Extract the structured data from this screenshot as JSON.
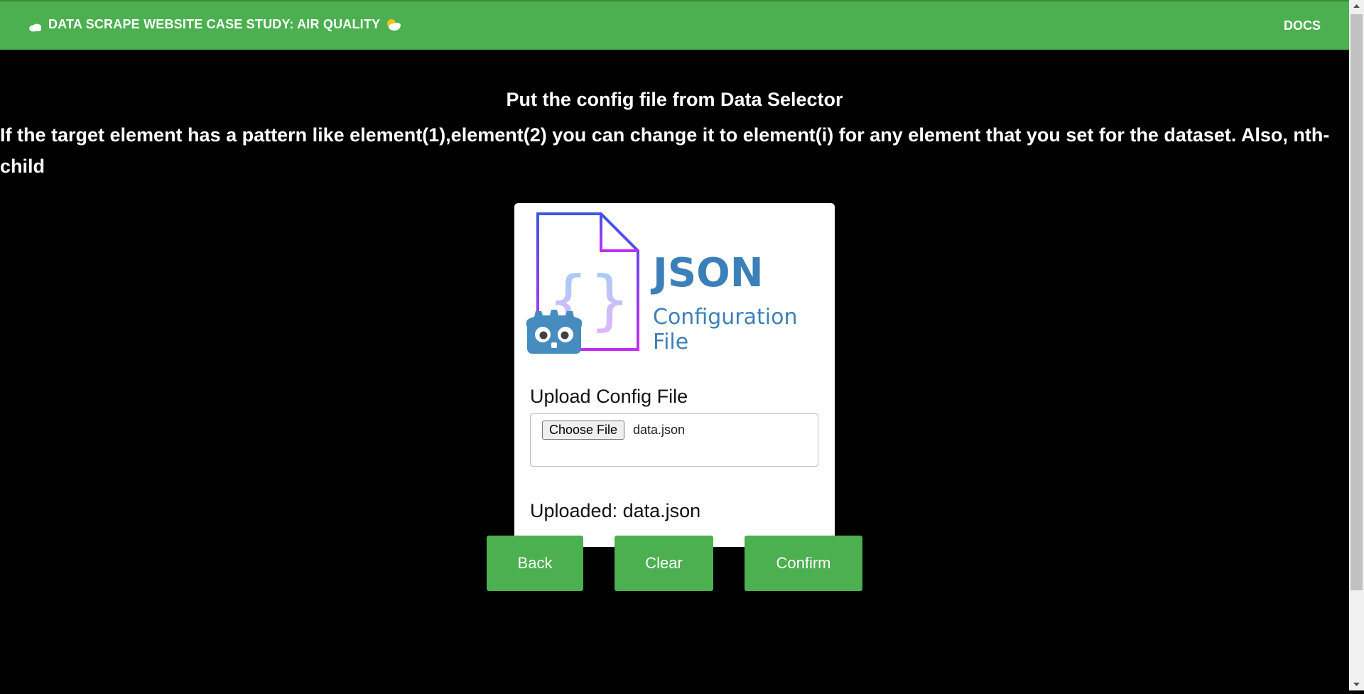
{
  "topbar": {
    "title": "DATA SCRAPE WEBSITE CASE STUDY: AIR QUALITY",
    "docs_label": "DOCS",
    "accent_color": "#4caf50"
  },
  "main": {
    "heading": "Put the config file from Data Selector",
    "description": "If the target element has a pattern like element(1),element(2) you can change it to element(i) for any element that you set for the dataset. Also, nth-child"
  },
  "card": {
    "logo": {
      "title": "JSON",
      "subtitle": "Configuration File",
      "icon": "json-file-icon",
      "badge_icon": "godot-robot-icon"
    },
    "upload_label": "Upload Config File",
    "file_input": {
      "button_label": "Choose File",
      "file_name": "data.json"
    },
    "uploaded_text": "Uploaded: data.json"
  },
  "actions": {
    "back_label": "Back",
    "clear_label": "Clear",
    "confirm_label": "Confirm"
  }
}
